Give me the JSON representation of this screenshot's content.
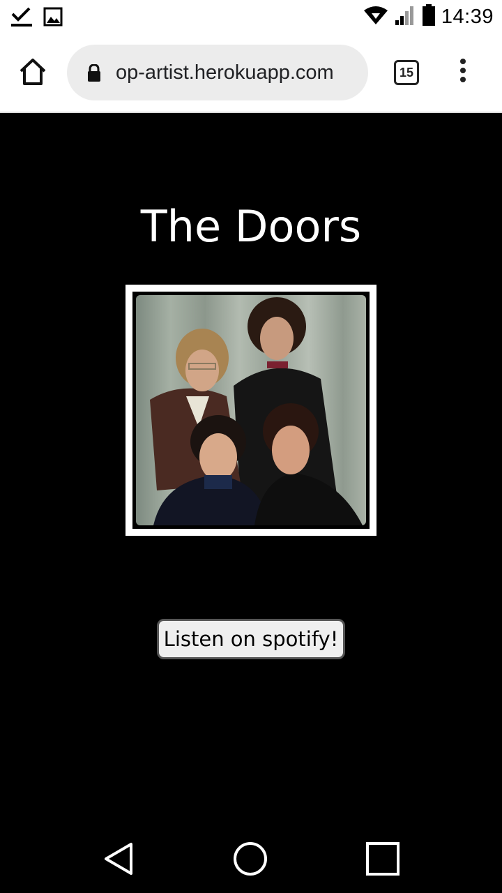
{
  "status_bar": {
    "time": "14:39",
    "tabs_count": "15",
    "icons": [
      "download-done-icon",
      "image-icon",
      "wifi-icon",
      "signal-icon",
      "battery-icon"
    ]
  },
  "browser": {
    "url": "op-artist.herokuapp.com",
    "icons": [
      "home-icon",
      "lock-icon",
      "tab-switcher-icon",
      "more-options-icon"
    ]
  },
  "page": {
    "artist_name": "The Doors",
    "button_label": "Listen on spotify!",
    "background_color": "#000000"
  },
  "nav_bar": {
    "icons": [
      "back-icon",
      "home-circle-icon",
      "recents-icon"
    ]
  }
}
